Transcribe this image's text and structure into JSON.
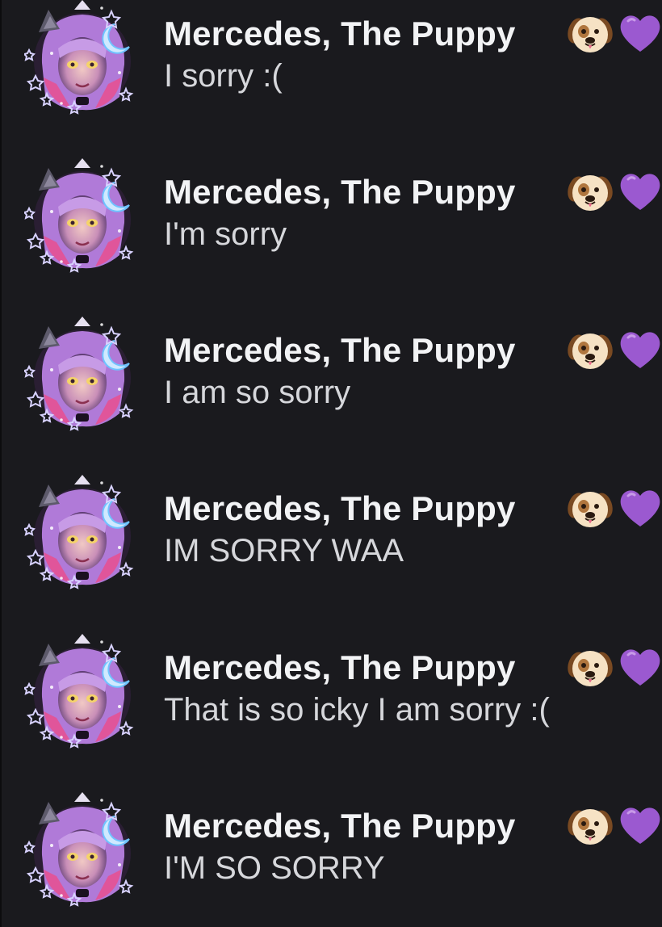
{
  "messages": [
    {
      "author": "Mercedes, The Puppy",
      "text": "I sorry :("
    },
    {
      "author": "Mercedes, The Puppy",
      "text": "I'm sorry"
    },
    {
      "author": "Mercedes, The Puppy",
      "text": "I am so sorry"
    },
    {
      "author": "Mercedes, The Puppy",
      "text": "IM SORRY WAA"
    },
    {
      "author": "Mercedes, The Puppy",
      "text": "That is so icky I am sorry :("
    },
    {
      "author": "Mercedes, The Puppy",
      "text": "I'M SO SORRY"
    }
  ],
  "name_emojis": [
    "dog-face-icon",
    "purple-heart-icon"
  ],
  "colors": {
    "background": "#1a1a1e",
    "username": "#f2f3f5",
    "message_text": "#d6d7db",
    "heart": "#9b59d0",
    "avatar_hair": "#b07ad8",
    "avatar_pink": "#e0559a"
  }
}
